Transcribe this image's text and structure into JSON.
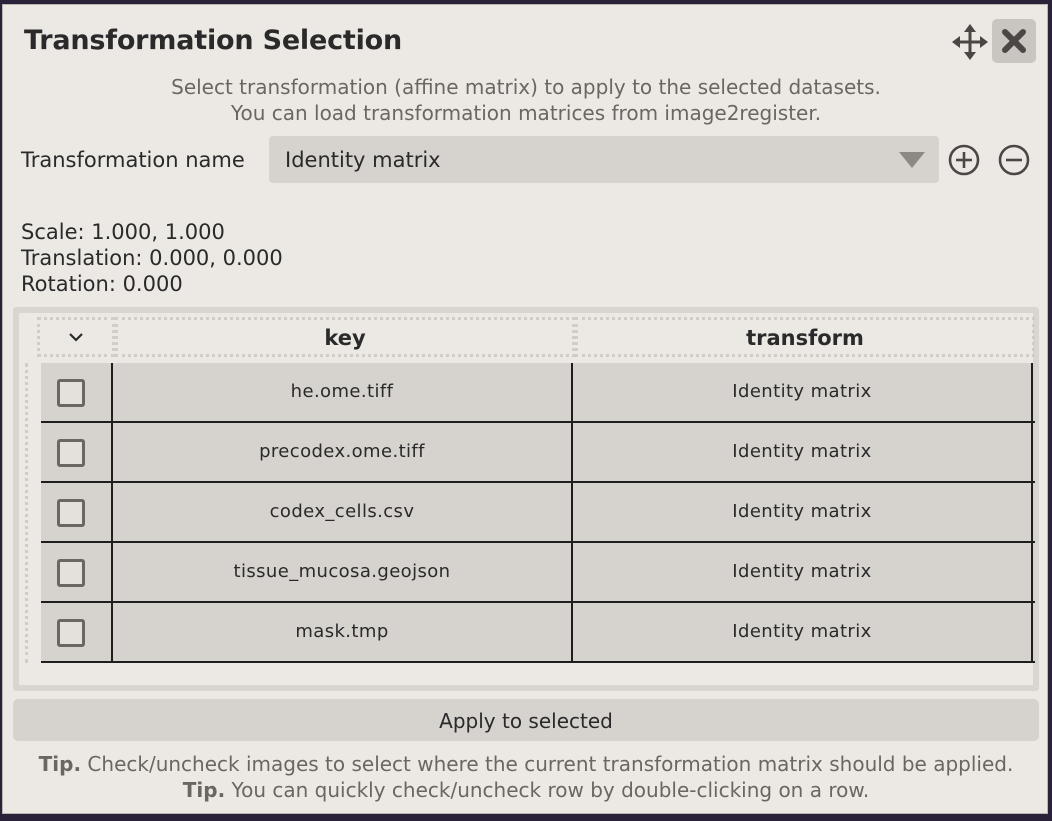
{
  "dialog": {
    "title": "Transformation Selection",
    "move_icon": "move-arrows-icon",
    "close_icon": "close-icon"
  },
  "description": {
    "line1": "Select transformation (affine matrix) to apply to the selected datasets.",
    "line2": "You can load transformation matrices from image2register."
  },
  "transformation": {
    "label": "Transformation name",
    "selected": "Identity matrix",
    "add_icon": "plus-circle-icon",
    "remove_icon": "minus-circle-icon"
  },
  "info": {
    "scale": "Scale: 1.000, 1.000",
    "translation": "Translation: 0.000, 0.000",
    "rotation": "Rotation: 0.000"
  },
  "table": {
    "columns": [
      "",
      "key",
      "transform"
    ],
    "rows": [
      {
        "checked": false,
        "key": "he.ome.tiff",
        "transform": "Identity matrix"
      },
      {
        "checked": false,
        "key": "precodex.ome.tiff",
        "transform": "Identity matrix"
      },
      {
        "checked": false,
        "key": "codex_cells.csv",
        "transform": "Identity matrix"
      },
      {
        "checked": false,
        "key": "tissue_mucosa.geojson",
        "transform": "Identity matrix"
      },
      {
        "checked": false,
        "key": "mask.tmp",
        "transform": "Identity matrix"
      }
    ]
  },
  "apply_label": "Apply to selected",
  "tips": [
    {
      "bold": "Tip.",
      "text": " Check/uncheck images to select where the current transformation matrix should be applied."
    },
    {
      "bold": "Tip.",
      "text": " You can quickly check/uncheck row by double-clicking on a row."
    }
  ]
}
